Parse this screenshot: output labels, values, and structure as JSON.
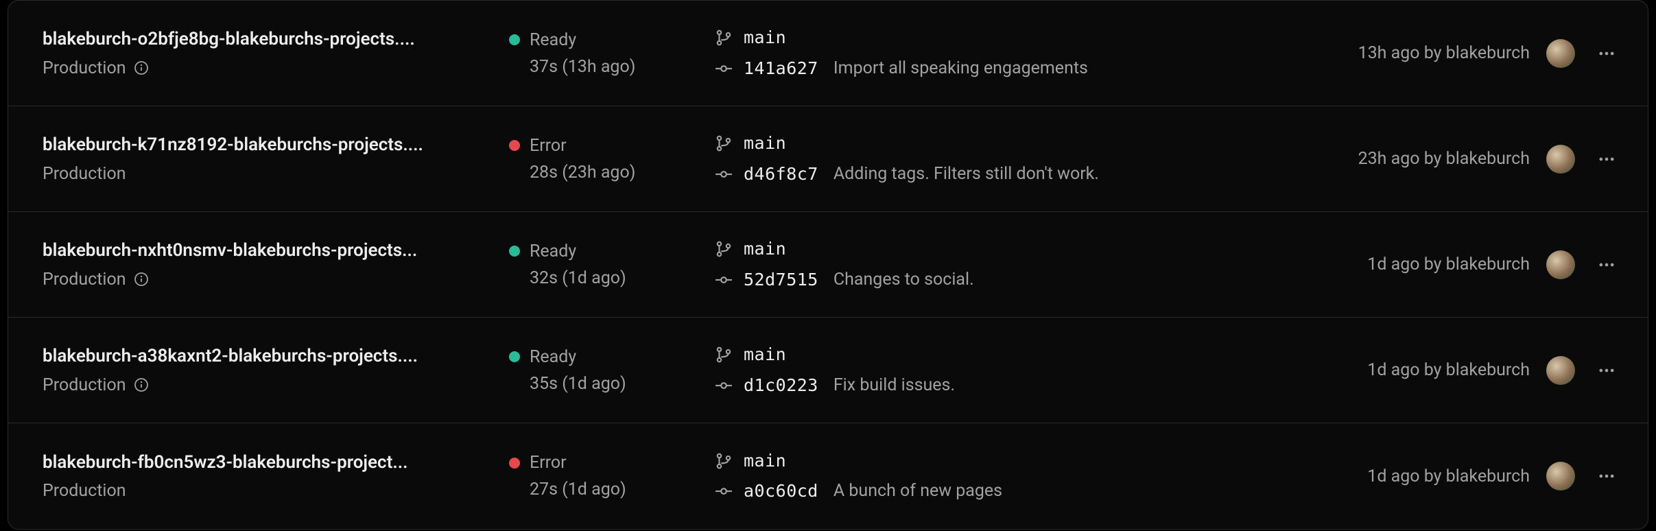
{
  "deployments": [
    {
      "name": "blakeburch-o2bfje8bg-blakeburchs-projects....",
      "env": "Production",
      "has_info_icon": true,
      "status": "Ready",
      "status_kind": "ready",
      "duration": "37s (13h ago)",
      "branch": "main",
      "commit_sha": "141a627",
      "commit_msg": "Import all speaking engagements",
      "time_author": "13h ago by blakeburch"
    },
    {
      "name": "blakeburch-k71nz8192-blakeburchs-projects....",
      "env": "Production",
      "has_info_icon": false,
      "status": "Error",
      "status_kind": "error",
      "duration": "28s (23h ago)",
      "branch": "main",
      "commit_sha": "d46f8c7",
      "commit_msg": "Adding tags. Filters still don't work.",
      "time_author": "23h ago by blakeburch"
    },
    {
      "name": "blakeburch-nxht0nsmv-blakeburchs-projects...",
      "env": "Production",
      "has_info_icon": true,
      "status": "Ready",
      "status_kind": "ready",
      "duration": "32s (1d ago)",
      "branch": "main",
      "commit_sha": "52d7515",
      "commit_msg": "Changes to social.",
      "time_author": "1d ago by blakeburch"
    },
    {
      "name": "blakeburch-a38kaxnt2-blakeburchs-projects....",
      "env": "Production",
      "has_info_icon": true,
      "status": "Ready",
      "status_kind": "ready",
      "duration": "35s (1d ago)",
      "branch": "main",
      "commit_sha": "d1c0223",
      "commit_msg": "Fix build issues.",
      "time_author": "1d ago by blakeburch"
    },
    {
      "name": "blakeburch-fb0cn5wz3-blakeburchs-project...",
      "env": "Production",
      "has_info_icon": false,
      "status": "Error",
      "status_kind": "error",
      "duration": "27s (1d ago)",
      "branch": "main",
      "commit_sha": "a0c60cd",
      "commit_msg": "A bunch of new pages",
      "time_author": "1d ago by blakeburch"
    }
  ]
}
